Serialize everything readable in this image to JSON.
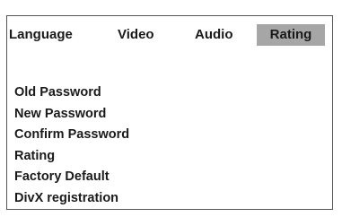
{
  "tabs": [
    {
      "label": "Language",
      "active": false
    },
    {
      "label": "Video",
      "active": false
    },
    {
      "label": "Audio",
      "active": false
    },
    {
      "label": "Rating",
      "active": true
    }
  ],
  "menu": {
    "items": [
      {
        "label": "Old Password"
      },
      {
        "label": "New Password"
      },
      {
        "label": "Confirm Password"
      },
      {
        "label": "Rating"
      },
      {
        "label": "Factory Default"
      },
      {
        "label": "DivX registration"
      }
    ]
  },
  "colors": {
    "active_tab_bg": "#a6a6a6",
    "border": "#555555",
    "text": "#1a1a1a",
    "background": "#ffffff"
  }
}
